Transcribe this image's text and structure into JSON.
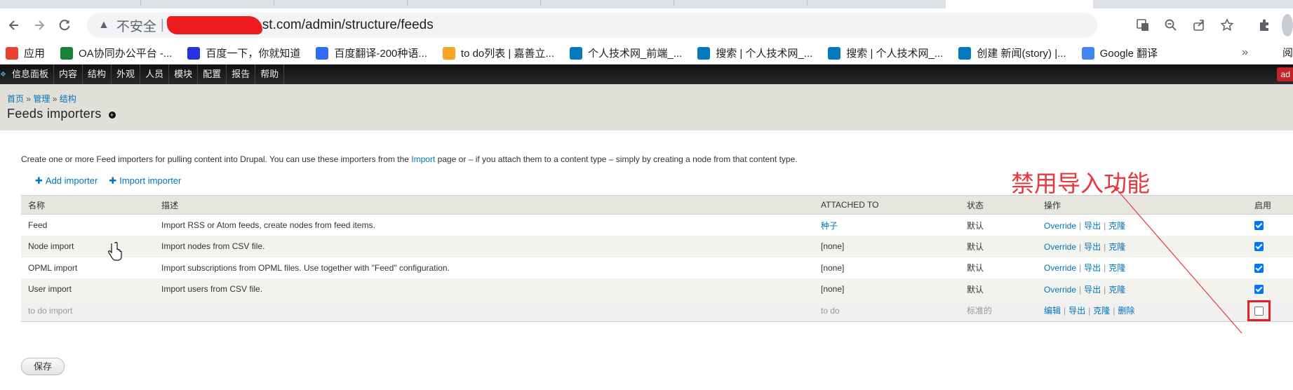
{
  "browser": {
    "url_insecure_label": "不安全",
    "url_suffix": "st.com/admin/structure/feeds",
    "bookmarks": [
      {
        "label": "应用",
        "icon": "apps-grid-icon",
        "color": "#e94235"
      },
      {
        "label": "OA协同办公平台 -...",
        "icon": "oa-logo-icon",
        "color": "#1a7f37"
      },
      {
        "label": "百度一下，你就知道",
        "icon": "baidu-paw-icon",
        "color": "#2932e1"
      },
      {
        "label": "百度翻译-200种语...",
        "icon": "baidu-translate-icon",
        "color": "#2f6ef2"
      },
      {
        "label": "to do列表 | 嘉善立...",
        "icon": "todo-logo-icon",
        "color": "#f5a623"
      },
      {
        "label": "个人技术网_前端_...",
        "icon": "drupal-drop-icon",
        "color": "#0678be"
      },
      {
        "label": "搜索 | 个人技术网_...",
        "icon": "drupal-drop-icon",
        "color": "#0678be"
      },
      {
        "label": "搜索 | 个人技术网_...",
        "icon": "drupal-drop-icon",
        "color": "#0678be"
      },
      {
        "label": "创建 新闻(story) |...",
        "icon": "drupal-drop-icon",
        "color": "#0678be"
      },
      {
        "label": "Google 翻译",
        "icon": "google-translate-icon",
        "color": "#4285f4"
      }
    ],
    "more_label": "»",
    "reading_label": "阅"
  },
  "admin_menu": {
    "items": [
      "信息面板",
      "内容",
      "结构",
      "外观",
      "人员",
      "模块",
      "配置",
      "报告",
      "帮助"
    ],
    "user_label": "ad"
  },
  "header": {
    "breadcrumb": [
      "首页",
      "管理",
      "结构"
    ],
    "breadcrumb_sep": "»",
    "title": "Feeds importers",
    "help_icon": "+"
  },
  "intro": {
    "before": "Create one or more Feed importers for pulling content into Drupal. You can use these importers from the ",
    "link": "Import",
    "after": " page or – if you attach them to a content type – simply by creating a node from that content type."
  },
  "actions": {
    "add": "Add importer",
    "import": "Import importer"
  },
  "table": {
    "headers": [
      "名称",
      "描述",
      "ATTACHED TO",
      "状态",
      "操作",
      "启用"
    ],
    "rows": [
      {
        "name": "Feed",
        "desc": "Import RSS or Atom feeds, create nodes from feed items.",
        "attached": "种子",
        "attached_link": true,
        "status": "默认",
        "ops": [
          "Override",
          "导出",
          "克隆"
        ],
        "enabled": true
      },
      {
        "name": "Node import",
        "desc": "Import nodes from CSV file.",
        "attached": "[none]",
        "attached_link": false,
        "status": "默认",
        "ops": [
          "Override",
          "导出",
          "克隆"
        ],
        "enabled": true
      },
      {
        "name": "OPML import",
        "desc": "Import subscriptions from OPML files. Use together with \"Feed\" configuration.",
        "attached": "[none]",
        "attached_link": false,
        "status": "默认",
        "ops": [
          "Override",
          "导出",
          "克隆"
        ],
        "enabled": true
      },
      {
        "name": "User import",
        "desc": "Import users from CSV file.",
        "attached": "[none]",
        "attached_link": false,
        "status": "默认",
        "ops": [
          "Override",
          "导出",
          "克隆"
        ],
        "enabled": true
      },
      {
        "name": "to do import",
        "desc": "",
        "attached": "to do",
        "attached_link": false,
        "status": "标准的",
        "ops": [
          "编辑",
          "导出",
          "克隆",
          "删除"
        ],
        "enabled": false
      }
    ]
  },
  "save_label": "保存",
  "annotation": {
    "text": "禁用导入功能",
    "color": "#e8383d"
  }
}
